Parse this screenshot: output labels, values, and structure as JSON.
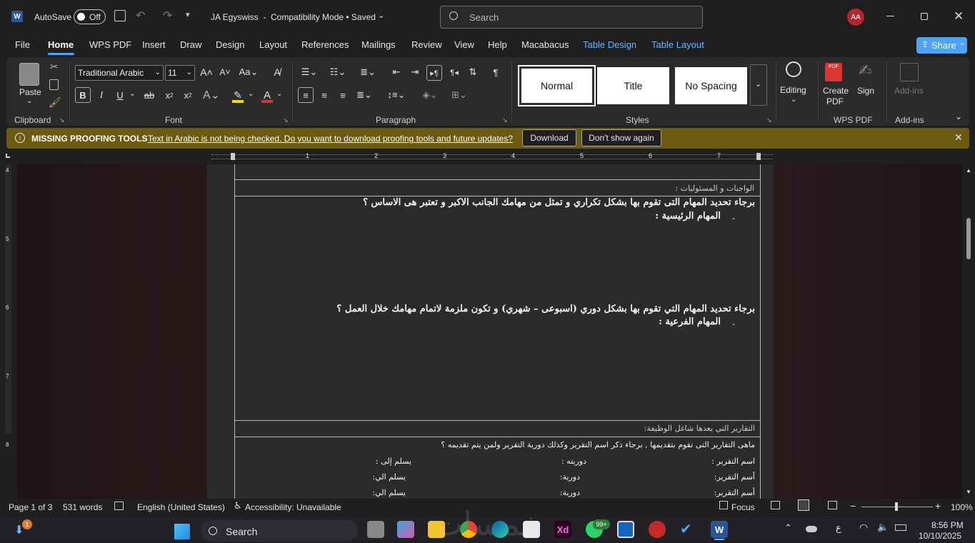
{
  "titlebar": {
    "autosave_label": "AutoSave",
    "autosave_state": "Off",
    "document_title": "JA Egyswiss  -  Compatibility Mode • Saved",
    "search_placeholder": "Search",
    "avatar_initials": "AA",
    "accent_color": "#b3262c"
  },
  "menu": {
    "items": [
      "File",
      "Home",
      "WPS PDF",
      "Insert",
      "Draw",
      "Design",
      "Layout",
      "References",
      "Mailings",
      "Review",
      "View",
      "Help",
      "Macabacus",
      "Table Design",
      "Table Layout"
    ],
    "active": "Home",
    "share_label": "Share"
  },
  "ribbon": {
    "clipboard": {
      "paste_label": "Paste",
      "group_label": "Clipboard"
    },
    "font": {
      "font_name": "Traditional Arabic",
      "font_size": "11",
      "group_label": "Font",
      "bold": "B",
      "italic": "I",
      "underline": "U",
      "strike": "ab",
      "subscript": "x",
      "superscript": "x",
      "highlight_color": "#ffd500",
      "font_color": "#e03030"
    },
    "paragraph": {
      "group_label": "Paragraph"
    },
    "styles": {
      "group_label": "Styles",
      "items": [
        "Normal",
        "Title",
        "No Spacing"
      ]
    },
    "editing": {
      "label": "Editing"
    },
    "wps_pdf": {
      "create_label": "Create PDF",
      "sign_label": "Sign",
      "group_label": "WPS PDF"
    },
    "addins": {
      "label": "Add-ins",
      "group_label": "Add-ins"
    }
  },
  "infobar": {
    "title": "MISSING PROOFING TOOLS",
    "message": "Text in Arabic is not being checked. Do you want to download proofing tools and future updates?",
    "download_label": "Download",
    "dismiss_label": "Don't show again"
  },
  "ruler": {
    "numbers": [
      "1",
      "2",
      "3",
      "4",
      "5",
      "6",
      "7"
    ]
  },
  "left_ruler": {
    "numbers": [
      "4",
      "5",
      "6",
      "7",
      "8"
    ]
  },
  "document": {
    "section1_header": "الواجبات و المسئوليات :",
    "q1": "برجاء تحديد المهام التى تقوم بها بشكل تكراري و تمثل من مهامك الجانب الاكبر و تعتبر هى الاساس ؟",
    "main_tasks": "المهام الرئيسية :",
    "q2": "برجاء تحديد المهام التي تقوم بها بشكل دوري (اسبوعى – شهري) و تكون ملزمة لاتمام مهامك خلال العمل ؟",
    "sub_tasks": "المهام الفرعية :",
    "dash": "-",
    "section2_header": "التقارير التي يعدها شاغل الوظيفة:",
    "q3": "ماهى التقارير التى تقوم بتقديمها , برجاء ذكر اسم التقرير وكذلك دورية التقرير ولمن يتم تقديمه ؟",
    "rows": [
      {
        "name": "اسم التقرير :",
        "period": "دوريته :",
        "to": "يسلم إلى :"
      },
      {
        "name": "أسم التقرير:",
        "period": "دورية:",
        "to": "يسلم الي:"
      },
      {
        "name": "أسم التقرير:",
        "period": "دورية:",
        "to": "يسلم الي:"
      }
    ]
  },
  "status": {
    "page": "Page 1 of 3",
    "words": "531 words",
    "language": "English (United States)",
    "accessibility": "Accessibility: Unavailable",
    "focus": "Focus",
    "zoom": "100%"
  },
  "taskbar": {
    "search_label": "Search",
    "badge_count": "99+",
    "notif_count": "1",
    "watermark": "خمسات",
    "lang": "ع",
    "time": "8:56 PM",
    "date": "10/10/2025"
  }
}
